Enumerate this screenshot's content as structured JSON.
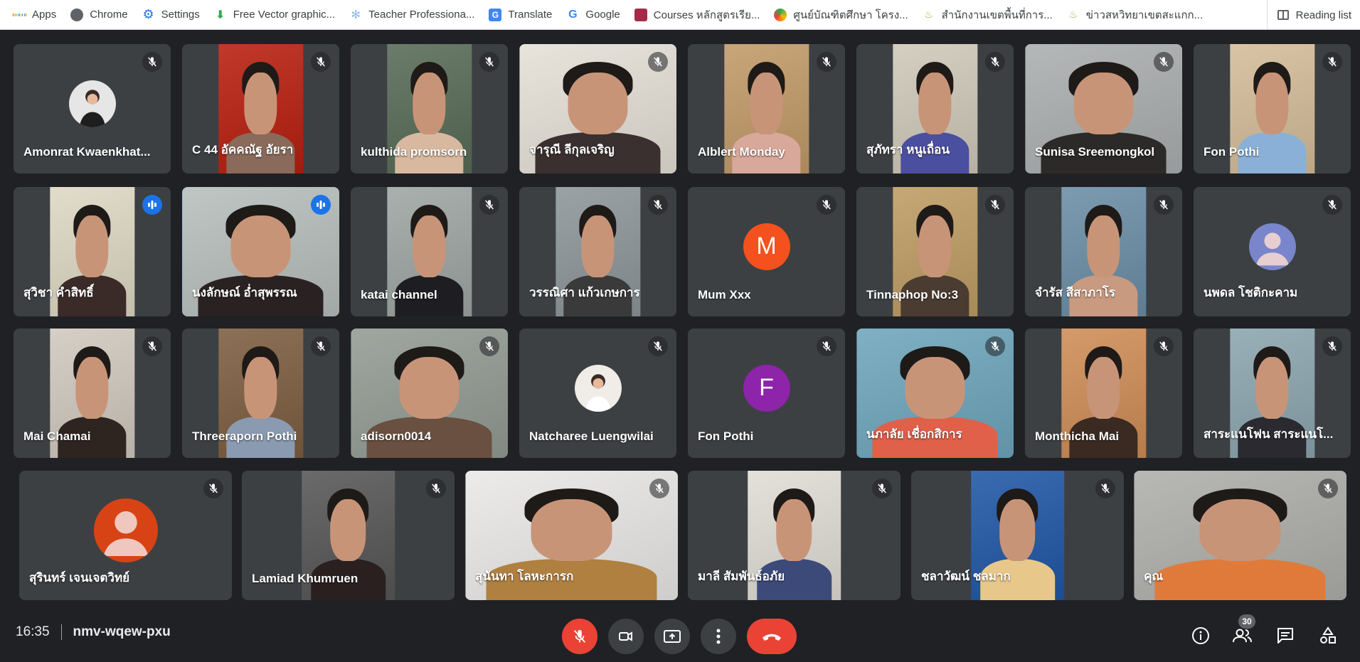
{
  "bookmarks": [
    {
      "label": "Apps",
      "icon": "apps-grid-icon",
      "color": "#ea4335"
    },
    {
      "label": "Chrome",
      "icon": "globe-icon",
      "color": "#5f6368"
    },
    {
      "label": "Settings",
      "icon": "gear-icon",
      "color": "#1a73e8"
    },
    {
      "label": "Free Vector graphic...",
      "icon": "download-icon",
      "color": "#34a853"
    },
    {
      "label": "Teacher Professiona...",
      "icon": "snowflake-icon",
      "color": "#8ab4f8"
    },
    {
      "label": "Translate",
      "icon": "translate-icon",
      "color": "#4285f4"
    },
    {
      "label": "Google",
      "icon": "google-icon",
      "color": "#4285f4"
    },
    {
      "label": "Courses หลักสูตรเรีย...",
      "icon": "courses-icon",
      "color": "#a52a4a"
    },
    {
      "label": "ศูนย์บัณฑิตศึกษา โครง...",
      "icon": "seal-icon",
      "color": "#34a853"
    },
    {
      "label": "สำนักงานเขตพื้นที่การ...",
      "icon": "emblem-icon",
      "color": "#c49a3c"
    },
    {
      "label": "ข่าวสหวิทยาเขตสะแกก...",
      "icon": "emblem-icon",
      "color": "#c49a3c"
    }
  ],
  "reading_list": "Reading list",
  "participants": [
    {
      "name": "Amonrat Kwaenkhat...",
      "mic": "muted",
      "kind": "avatar-photo",
      "bg": "#3c4043",
      "tone": "#e6e6e6"
    },
    {
      "name": "C 44 อัคคณัฐ อัยรา",
      "mic": "muted",
      "kind": "video",
      "bg": "#c0392b",
      "tone": "#8a6a5a"
    },
    {
      "name": "kulthida promsorn",
      "mic": "muted",
      "kind": "video",
      "bg": "#6b7d6a",
      "tone": "#d8b9a0"
    },
    {
      "name": "จารุณี ลีกุลเจริญ",
      "mic": "muted",
      "kind": "video",
      "bg": "#e8e4dc",
      "tone": "#3a3030"
    },
    {
      "name": "Alblert Monday",
      "mic": "muted",
      "kind": "video",
      "bg": "#c9a57a",
      "tone": "#d8a89a"
    },
    {
      "name": "สุภัทรา หนูเถื่อน",
      "mic": "muted",
      "kind": "video",
      "bg": "#d5cfc2",
      "tone": "#4b4fa0"
    },
    {
      "name": "Sunisa Sreemongkol",
      "mic": "muted",
      "kind": "video",
      "bg": "#b5b8b8",
      "tone": "#2c2a28"
    },
    {
      "name": "Fon Pothi",
      "mic": "muted",
      "kind": "video",
      "bg": "#d9c5a5",
      "tone": "#8ab0d8"
    },
    {
      "name": "สุวิชา คำสิทธิ์",
      "mic": "speaking",
      "kind": "video",
      "bg": "#e2dccb",
      "tone": "#3a2a28"
    },
    {
      "name": "นงลักษณ์ อ่ำสุพรรณ",
      "mic": "speaking",
      "kind": "video",
      "bg": "#bfc6c4",
      "tone": "#2a2222",
      "active": true
    },
    {
      "name": "katai channel",
      "mic": "muted",
      "kind": "video",
      "bg": "#a9b0ad",
      "tone": "#1e1e22"
    },
    {
      "name": "วรรณิศา แก้วเกษการ",
      "mic": "muted",
      "kind": "video",
      "bg": "#9aa2a5",
      "tone": "#3a3a3a"
    },
    {
      "name": "Mum Xxx",
      "mic": "muted",
      "kind": "letter",
      "letter": "M",
      "bg": "#3c4043",
      "tone": "#f4511e"
    },
    {
      "name": "Tinnaphop No:3",
      "mic": "muted",
      "kind": "video",
      "bg": "#c6a877",
      "tone": "#4a3c30"
    },
    {
      "name": "จำรัส สีสาภาโร",
      "mic": "muted",
      "kind": "video",
      "bg": "#7c9bb0",
      "tone": "#c89a80"
    },
    {
      "name": "นพดล โชติกะคาม",
      "mic": "muted",
      "kind": "default",
      "bg": "#3c4043",
      "tone": "#7986cb"
    },
    {
      "name": "Mai Chamai",
      "mic": "muted",
      "kind": "video",
      "bg": "#d6cfc6",
      "tone": "#2e2420"
    },
    {
      "name": "Threeraporn Pothi",
      "mic": "muted",
      "kind": "video",
      "bg": "#8c7157",
      "tone": "#8a9ab0"
    },
    {
      "name": "adisorn0014",
      "mic": "muted",
      "kind": "video",
      "bg": "#9fa7a0",
      "tone": "#6a5040"
    },
    {
      "name": "Natcharee Luengwilai",
      "mic": "muted",
      "kind": "avatar-photo",
      "bg": "#3c4043",
      "tone": "#f0ece8"
    },
    {
      "name": "Fon Pothi",
      "mic": "muted",
      "kind": "letter",
      "letter": "F",
      "bg": "#3c4043",
      "tone": "#8e24aa"
    },
    {
      "name": "นภาลัย เชื่อกสิการ",
      "mic": "muted",
      "kind": "video",
      "bg": "#7fb0c4",
      "tone": "#e0604a"
    },
    {
      "name": "Monthicha Mai",
      "mic": "muted",
      "kind": "video",
      "bg": "#d49a6a",
      "tone": "#3a2a22"
    },
    {
      "name": "สาระแนโฟน สาระแนโ...",
      "mic": "muted",
      "kind": "video",
      "bg": "#9ab0b8",
      "tone": "#2a2a30"
    },
    {
      "name": "สุรินทร์ เจนเจตวิทย์",
      "mic": "muted",
      "kind": "default",
      "bg": "#3c4043",
      "tone": "#d84315"
    },
    {
      "name": "Lamiad Khumruen",
      "mic": "muted",
      "kind": "video",
      "bg": "#6a6a6a",
      "tone": "#2a2020"
    },
    {
      "name": "สุนันทา โลหะการก",
      "mic": "muted",
      "kind": "video",
      "bg": "#ecebea",
      "tone": "#b08040"
    },
    {
      "name": "มาลี สัมพันธ์อภัย",
      "mic": "muted",
      "kind": "video",
      "bg": "#e4e0da",
      "tone": "#3c4a7a"
    },
    {
      "name": "ชลาวัฒน์ ชลมาก",
      "mic": "muted",
      "kind": "video",
      "bg": "#3a6ab0",
      "tone": "#e8c88a"
    },
    {
      "name": "คุณ",
      "mic": "muted",
      "kind": "video",
      "bg": "#b8b8b4",
      "tone": "#e07a3a"
    }
  ],
  "controls": {
    "time": "16:35",
    "meeting_code": "nmv-wqew-pxu",
    "participant_count": "30"
  },
  "colors": {
    "accent_blue": "#8ab4f8",
    "speaking_blue": "#1a73e8",
    "end_call_red": "#ea4335"
  }
}
